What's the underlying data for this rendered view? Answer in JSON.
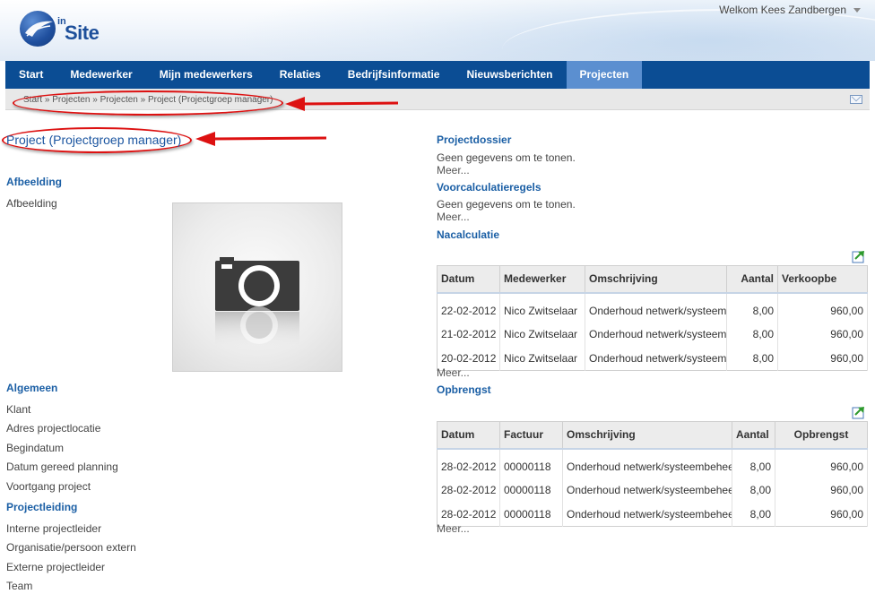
{
  "header": {
    "logo_prefix": "in",
    "logo_text": "Site",
    "welcome": "Welkom Kees Zandbergen"
  },
  "nav": {
    "items": [
      {
        "label": "Start",
        "active": false
      },
      {
        "label": "Medewerker",
        "active": false
      },
      {
        "label": "Mijn medewerkers",
        "active": false
      },
      {
        "label": "Relaties",
        "active": false
      },
      {
        "label": "Bedrijfsinformatie",
        "active": false
      },
      {
        "label": "Nieuwsberichten",
        "active": false
      },
      {
        "label": "Projecten",
        "active": true
      }
    ]
  },
  "breadcrumb": "Start » Projecten » Projecten » Project (Projectgroep manager)",
  "page_title": "Project (Projectgroep manager)",
  "left": {
    "afbeelding_header": "Afbeelding",
    "afbeelding_label": "Afbeelding",
    "algemeen_header": "Algemeen",
    "algemeen_fields": [
      "Klant",
      "Adres projectlocatie",
      "Begindatum",
      "Datum gereed planning",
      "Voortgang project"
    ],
    "projectleiding_header": "Projectleiding",
    "projectleiding_fields": [
      "Interne projectleider",
      "Organisatie/persoon extern",
      "Externe projectleider",
      "Team"
    ]
  },
  "right": {
    "projectdossier": {
      "header": "Projectdossier",
      "empty": "Geen gegevens om te tonen.",
      "more": "Meer..."
    },
    "voorcalculatie": {
      "header": "Voorcalculatieregels",
      "empty": "Geen gegevens om te tonen.",
      "more": "Meer..."
    },
    "nacalculatie": {
      "header": "Nacalculatie",
      "columns": [
        "Datum",
        "Medewerker",
        "Omschrijving",
        "Aantal",
        "Verkoopbe"
      ],
      "rows": [
        [
          "22-02-2012",
          "Nico Zwitselaar",
          "Onderhoud netwerk/systeemb",
          "8,00",
          "960,00"
        ],
        [
          "21-02-2012",
          "Nico Zwitselaar",
          "Onderhoud netwerk/systeemb",
          "8,00",
          "960,00"
        ],
        [
          "20-02-2012",
          "Nico Zwitselaar",
          "Onderhoud netwerk/systeemb",
          "8,00",
          "960,00"
        ]
      ],
      "more": "Meer..."
    },
    "opbrengst": {
      "header": "Opbrengst",
      "columns": [
        "Datum",
        "Factuur",
        "Omschrijving",
        "Aantal",
        "Opbrengst"
      ],
      "rows": [
        [
          "28-02-2012",
          "00000118",
          "Onderhoud netwerk/systeembeheer",
          "8,00",
          "960,00"
        ],
        [
          "28-02-2012",
          "00000118",
          "Onderhoud netwerk/systeembeheer",
          "8,00",
          "960,00"
        ],
        [
          "28-02-2012",
          "00000118",
          "Onderhoud netwerk/systeembeheer",
          "8,00",
          "960,00"
        ]
      ],
      "more": "Meer..."
    }
  },
  "colors": {
    "nav_bg": "#0b4d94",
    "nav_active": "#5b8fd0",
    "section_header": "#1b5fa5",
    "annotation": "#dd1111"
  }
}
